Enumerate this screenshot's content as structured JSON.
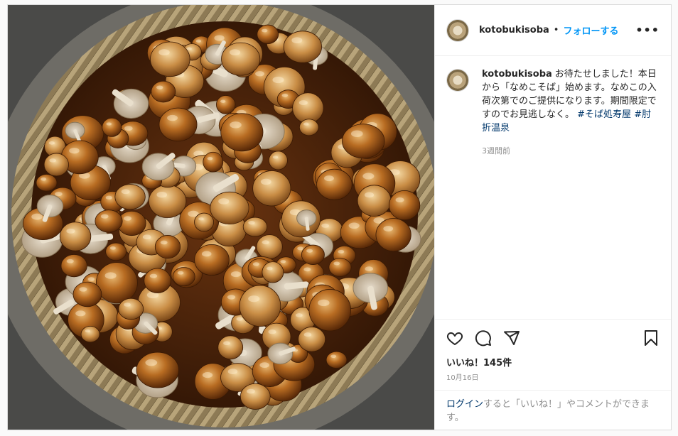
{
  "post": {
    "image_alt": "なめこ in a woven bamboo basket",
    "username": "kotobukisoba",
    "separator": "•",
    "follow_label": "フォローする",
    "more_label": "•••"
  },
  "caption": {
    "username": "kotobukisoba",
    "text": "お待たせしました！本日から「なめこそば」始めます。なめこの入荷次第でのご提供になります。期間限定ですのでお見逃しなく。",
    "hashtags": [
      "#そば処寿屋",
      "#肘折温泉"
    ],
    "time": "3週間前"
  },
  "actions": {
    "icons": [
      "heart-icon",
      "comment-icon",
      "share-icon",
      "bookmark-icon"
    ]
  },
  "likes": "いいね！145件",
  "date": "10月16日",
  "login_prompt": {
    "link": "ログイン",
    "text": "すると「いいね！」やコメントができます。"
  },
  "colors": {
    "accent": "#0095f6",
    "link": "#00376b",
    "muted": "#8e8e8e",
    "border": "#dbdbdb"
  }
}
